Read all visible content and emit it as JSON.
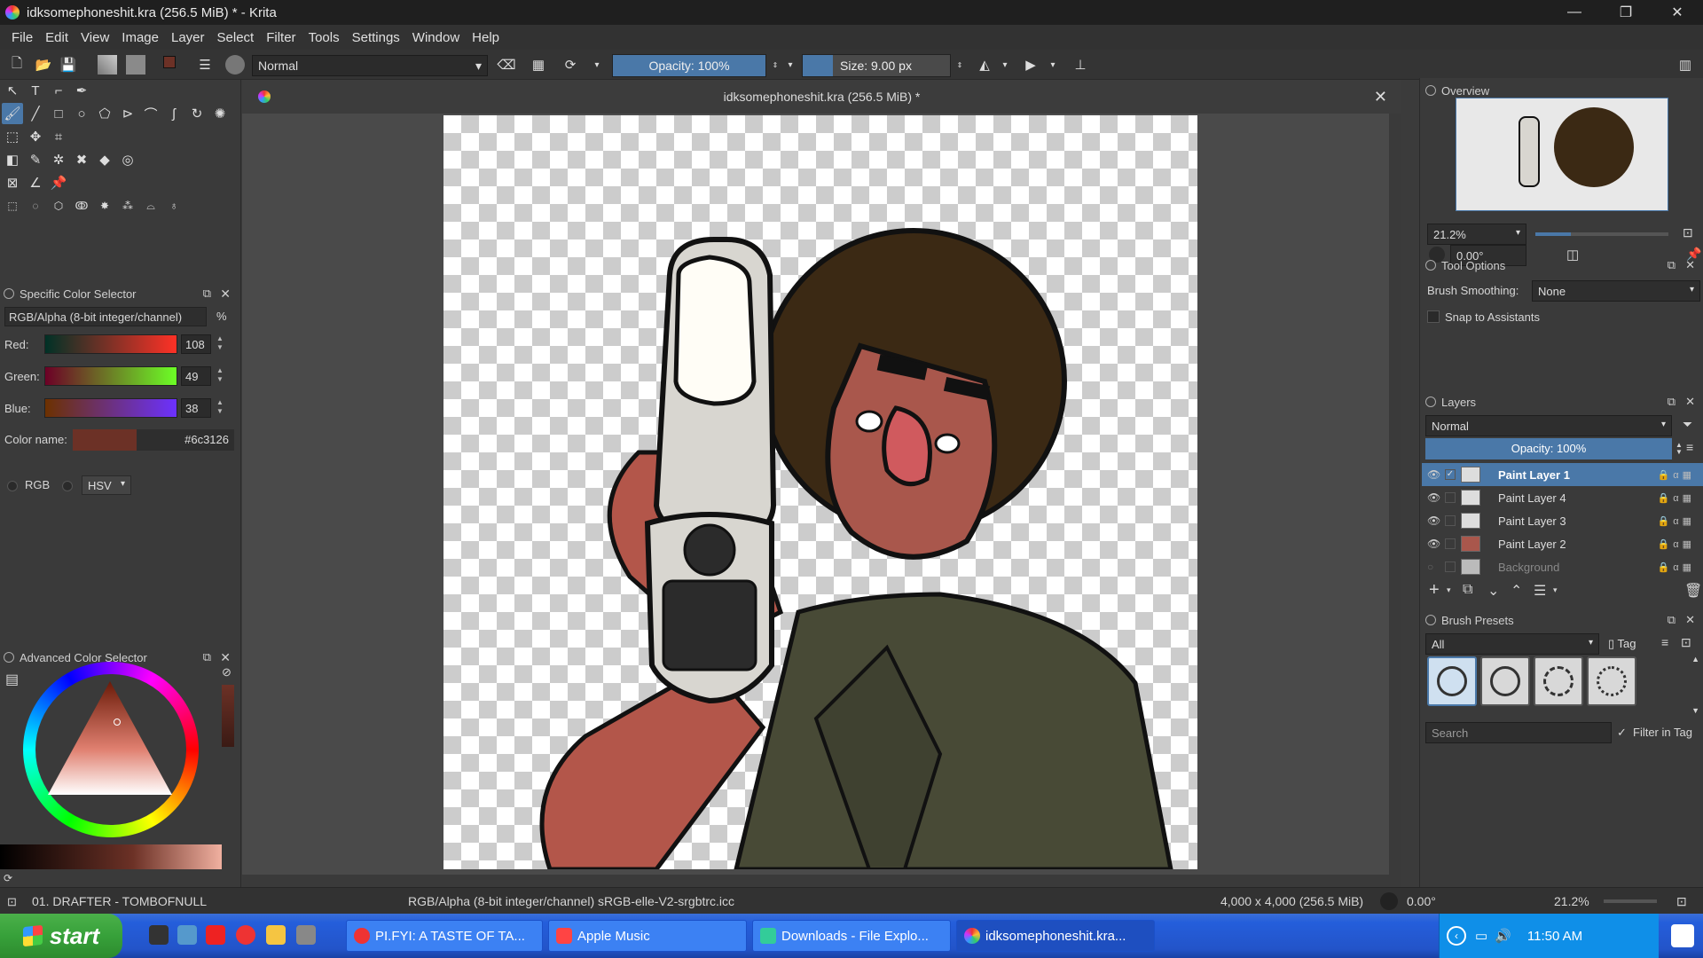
{
  "window": {
    "title": "idksomephoneshit.kra (256.5 MiB) * - Krita",
    "minimize": "—",
    "maximize": "❐",
    "close": "✕"
  },
  "menu": [
    "File",
    "Edit",
    "View",
    "Image",
    "Layer",
    "Select",
    "Filter",
    "Tools",
    "Settings",
    "Window",
    "Help"
  ],
  "toolbar": {
    "blend_mode": "Normal",
    "opacity": "Opacity: 100%",
    "size": "Size: 9.00 px"
  },
  "document": {
    "tab_title": "idksomephoneshit.kra (256.5 MiB) *"
  },
  "specific_color_selector": {
    "title": "Specific Color Selector",
    "color_space": "RGB/Alpha (8-bit integer/channel)",
    "percent": "%",
    "red_label": "Red:",
    "red": "108",
    "green_label": "Green:",
    "green": "49",
    "blue_label": "Blue:",
    "blue": "38",
    "color_name_label": "Color name:",
    "color_name": "#6c3126",
    "mode_rgb": "RGB",
    "mode_hsv": "HSV"
  },
  "advanced_color_selector": {
    "title": "Advanced Color Selector"
  },
  "overview": {
    "title": "Overview",
    "zoom": "21.2%",
    "rotation": "0.00°"
  },
  "tool_options": {
    "title": "Tool Options",
    "brush_smoothing_label": "Brush Smoothing:",
    "brush_smoothing": "None",
    "snap_label": "Snap to Assistants"
  },
  "layers": {
    "title": "Layers",
    "blend_mode": "Normal",
    "opacity": "Opacity:  100%",
    "items": [
      {
        "name": "Paint Layer 1",
        "selected": true
      },
      {
        "name": "Paint Layer 4"
      },
      {
        "name": "Paint Layer 3"
      },
      {
        "name": "Paint Layer 2"
      },
      {
        "name": "Background"
      }
    ]
  },
  "brush_presets": {
    "title": "Brush Presets",
    "filter": "All",
    "tag": "Tag",
    "search_placeholder": "Search",
    "filter_in_tag": "Filter in Tag"
  },
  "status": {
    "brush": "01. DRAFTER - TOMBOFNULL",
    "color_profile": "RGB/Alpha (8-bit integer/channel)  sRGB-elle-V2-srgbtrc.icc",
    "dimensions": "4,000 x 4,000 (256.5 MiB)",
    "rotation": "0.00°",
    "zoom": "21.2%"
  },
  "taskbar": {
    "start": "start",
    "tasks": [
      "PI.FYI: A TASTE OF TA...",
      "Apple Music",
      "Downloads - File Explo...",
      "idksomephoneshit.kra..."
    ],
    "clock": "11:50 AM"
  },
  "colors": {
    "accent": "#4a78a8",
    "current_color": "#6c3126",
    "taskbar": "#245edb",
    "start": "#37a13a"
  }
}
